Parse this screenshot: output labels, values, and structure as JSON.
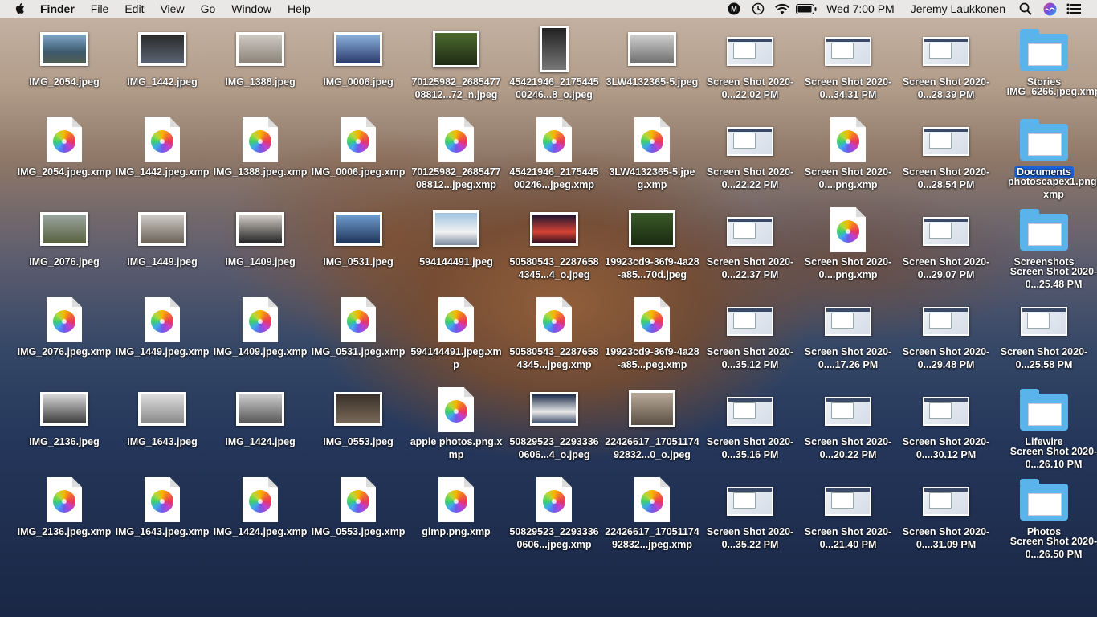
{
  "menubar": {
    "app": "Finder",
    "menus": [
      "File",
      "Edit",
      "View",
      "Go",
      "Window",
      "Help"
    ],
    "clock": "Wed 7:00 PM",
    "user": "Jeremy Laukkonen",
    "icons": [
      "apple-icon",
      "malwarebytes-icon",
      "time-machine-icon",
      "wifi-icon",
      "battery-icon",
      "spotlight-icon",
      "siri-icon",
      "control-list-icon"
    ]
  },
  "desktop": {
    "columns": [
      [
        "IMG_2054.jpeg",
        "IMG_2054.jpeg.xmp",
        "IMG_2076.jpeg",
        "IMG_2076.jpeg.xmp",
        "IMG_2136.jpeg",
        "IMG_2136.jpeg.xmp"
      ],
      [
        "IMG_1442.jpeg",
        "IMG_1442.jpeg.xmp",
        "IMG_1449.jpeg",
        "IMG_1449.jpeg.xmp",
        "IMG_1643.jpeg",
        "IMG_1643.jpeg.xmp"
      ],
      [
        "IMG_1388.jpeg",
        "IMG_1388.jpeg.xmp",
        "IMG_1409.jpeg",
        "IMG_1409.jpeg.xmp",
        "IMG_1424.jpeg",
        "IMG_1424.jpeg.xmp"
      ],
      [
        "IMG_0006.jpeg",
        "IMG_0006.jpeg.xmp",
        "IMG_0531.jpeg",
        "IMG_0531.jpeg.xmp",
        "IMG_0553.jpeg",
        "IMG_0553.jpeg.xmp"
      ],
      [
        "70125982_268547708812...72_n.jpeg",
        "70125982_268547708812...jpeg.xmp",
        "594144491.jpeg",
        "594144491.jpeg.xmp",
        "apple photos.png.xmp",
        "gimp.png.xmp"
      ],
      [
        "45421946_217544500246...8_o.jpeg",
        "45421946_217544500246...jpeg.xmp",
        "50580543_22876584345...4_o.jpeg",
        "50580543_22876584345...jpeg.xmp",
        "50829523_22933360606...4_o.jpeg",
        "50829523_22933360606...jpeg.xmp"
      ],
      [
        "3LW4132365-5.jpeg",
        "3LW4132365-5.jpeg.xmp",
        "19923cd9-36f9-4a28-a85...70d.jpeg",
        "19923cd9-36f9-4a28-a85...peg.xmp",
        "22426617_1705117492832...0_o.jpeg",
        "22426617_1705117492832...jpeg.xmp"
      ],
      [
        "Screen Shot 2020-0...22.02 PM",
        "Screen Shot 2020-0...22.22 PM",
        "Screen Shot 2020-0...22.37 PM",
        "Screen Shot 2020-0...35.12 PM",
        "Screen Shot 2020-0...35.16 PM",
        "Screen Shot 2020-0...35.22 PM"
      ],
      [
        "Screen Shot 2020-0...34.31 PM",
        "Screen Shot 2020-0....png.xmp",
        "Screen Shot 2020-0....png.xmp",
        "Screen Shot 2020-0....17.26 PM",
        "Screen Shot 2020-0...20.22 PM",
        "Screen Shot 2020-0...21.40 PM"
      ],
      [
        "Screen Shot 2020-0...28.39 PM",
        "Screen Shot 2020-0...28.54 PM",
        "Screen Shot 2020-0...29.07 PM",
        "Screen Shot 2020-0...29.48 PM",
        "Screen Shot 2020-0....30.12 PM",
        "Screen Shot 2020-0....31.09 PM"
      ],
      [
        "Stories",
        "Documents",
        "Screenshots",
        "Screen Shot 2020-0...25.58 PM",
        "Lifewire",
        "Photos"
      ]
    ],
    "col11_overlays": [
      "IMG_6266.jpeg.xmp",
      "photoscapex1.png.xmp",
      "Screen Shot 2020-0...25.48 PM",
      "Screen Shot 2020-0...26.10 PM",
      "Screen Shot 2020-0...26.50 PM"
    ]
  }
}
